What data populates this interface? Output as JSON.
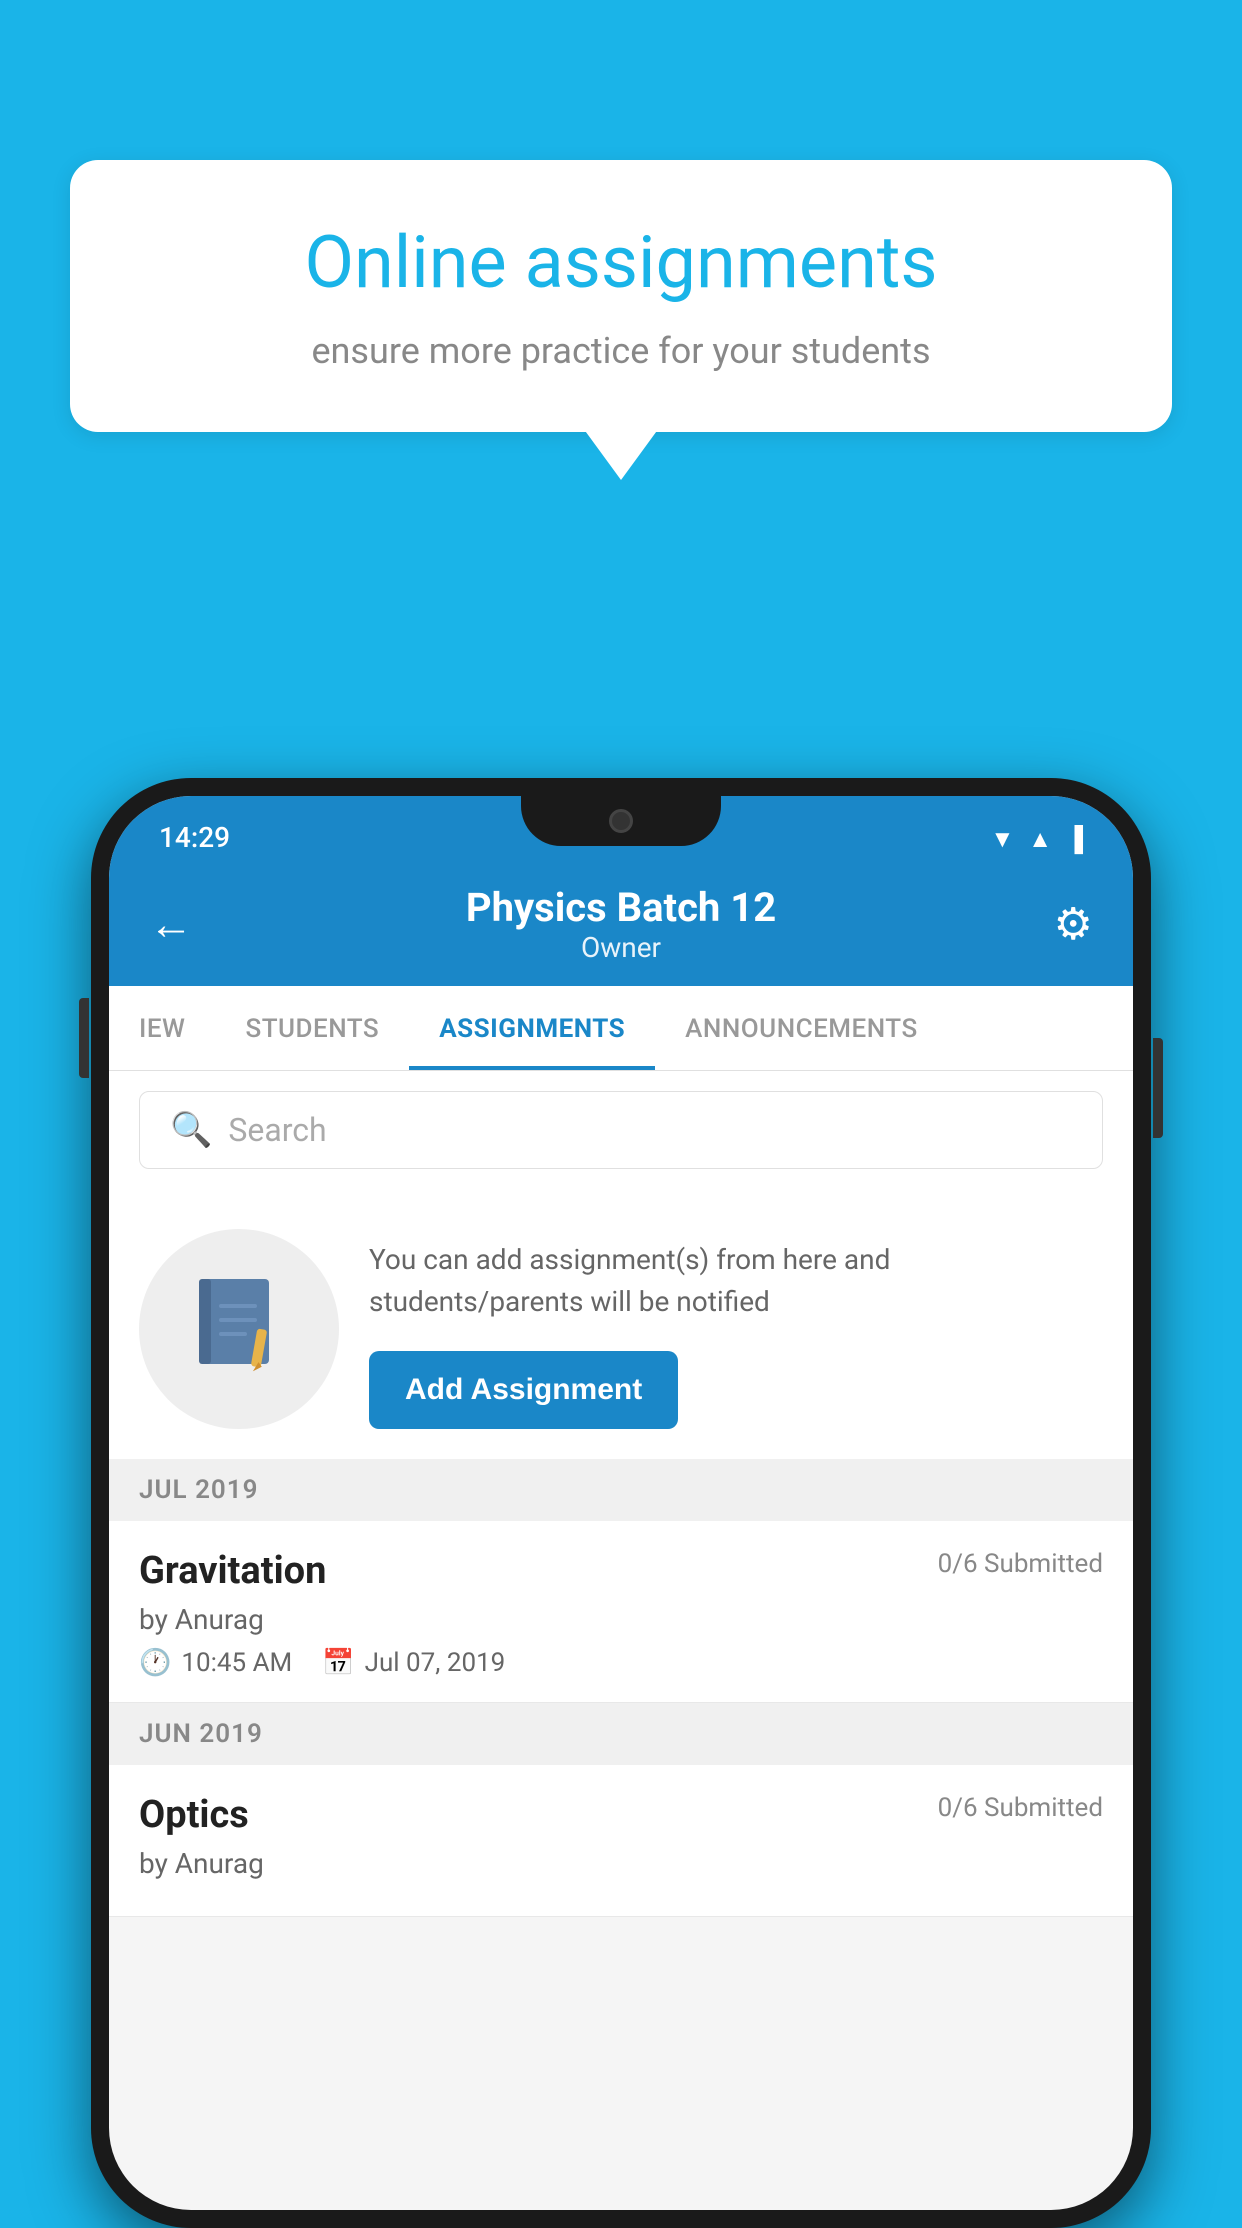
{
  "background": {
    "color": "#1ab4e8"
  },
  "speech_bubble": {
    "title": "Online assignments",
    "subtitle": "ensure more practice for your students"
  },
  "status_bar": {
    "time": "14:29"
  },
  "header": {
    "title": "Physics Batch 12",
    "subtitle": "Owner",
    "back_label": "←",
    "settings_icon": "⚙"
  },
  "tabs": [
    {
      "label": "IEW",
      "active": false
    },
    {
      "label": "STUDENTS",
      "active": false
    },
    {
      "label": "ASSIGNMENTS",
      "active": true
    },
    {
      "label": "ANNOUNCEMENTS",
      "active": false
    }
  ],
  "search": {
    "placeholder": "Search"
  },
  "cta": {
    "description": "You can add assignment(s) from here and students/parents will be notified",
    "button_label": "Add Assignment"
  },
  "sections": [
    {
      "month": "JUL 2019",
      "assignments": [
        {
          "name": "Gravitation",
          "submitted": "0/6 Submitted",
          "author": "by Anurag",
          "time": "10:45 AM",
          "date": "Jul 07, 2019"
        }
      ]
    },
    {
      "month": "JUN 2019",
      "assignments": [
        {
          "name": "Optics",
          "submitted": "0/6 Submitted",
          "author": "by Anurag",
          "time": "",
          "date": ""
        }
      ]
    }
  ]
}
